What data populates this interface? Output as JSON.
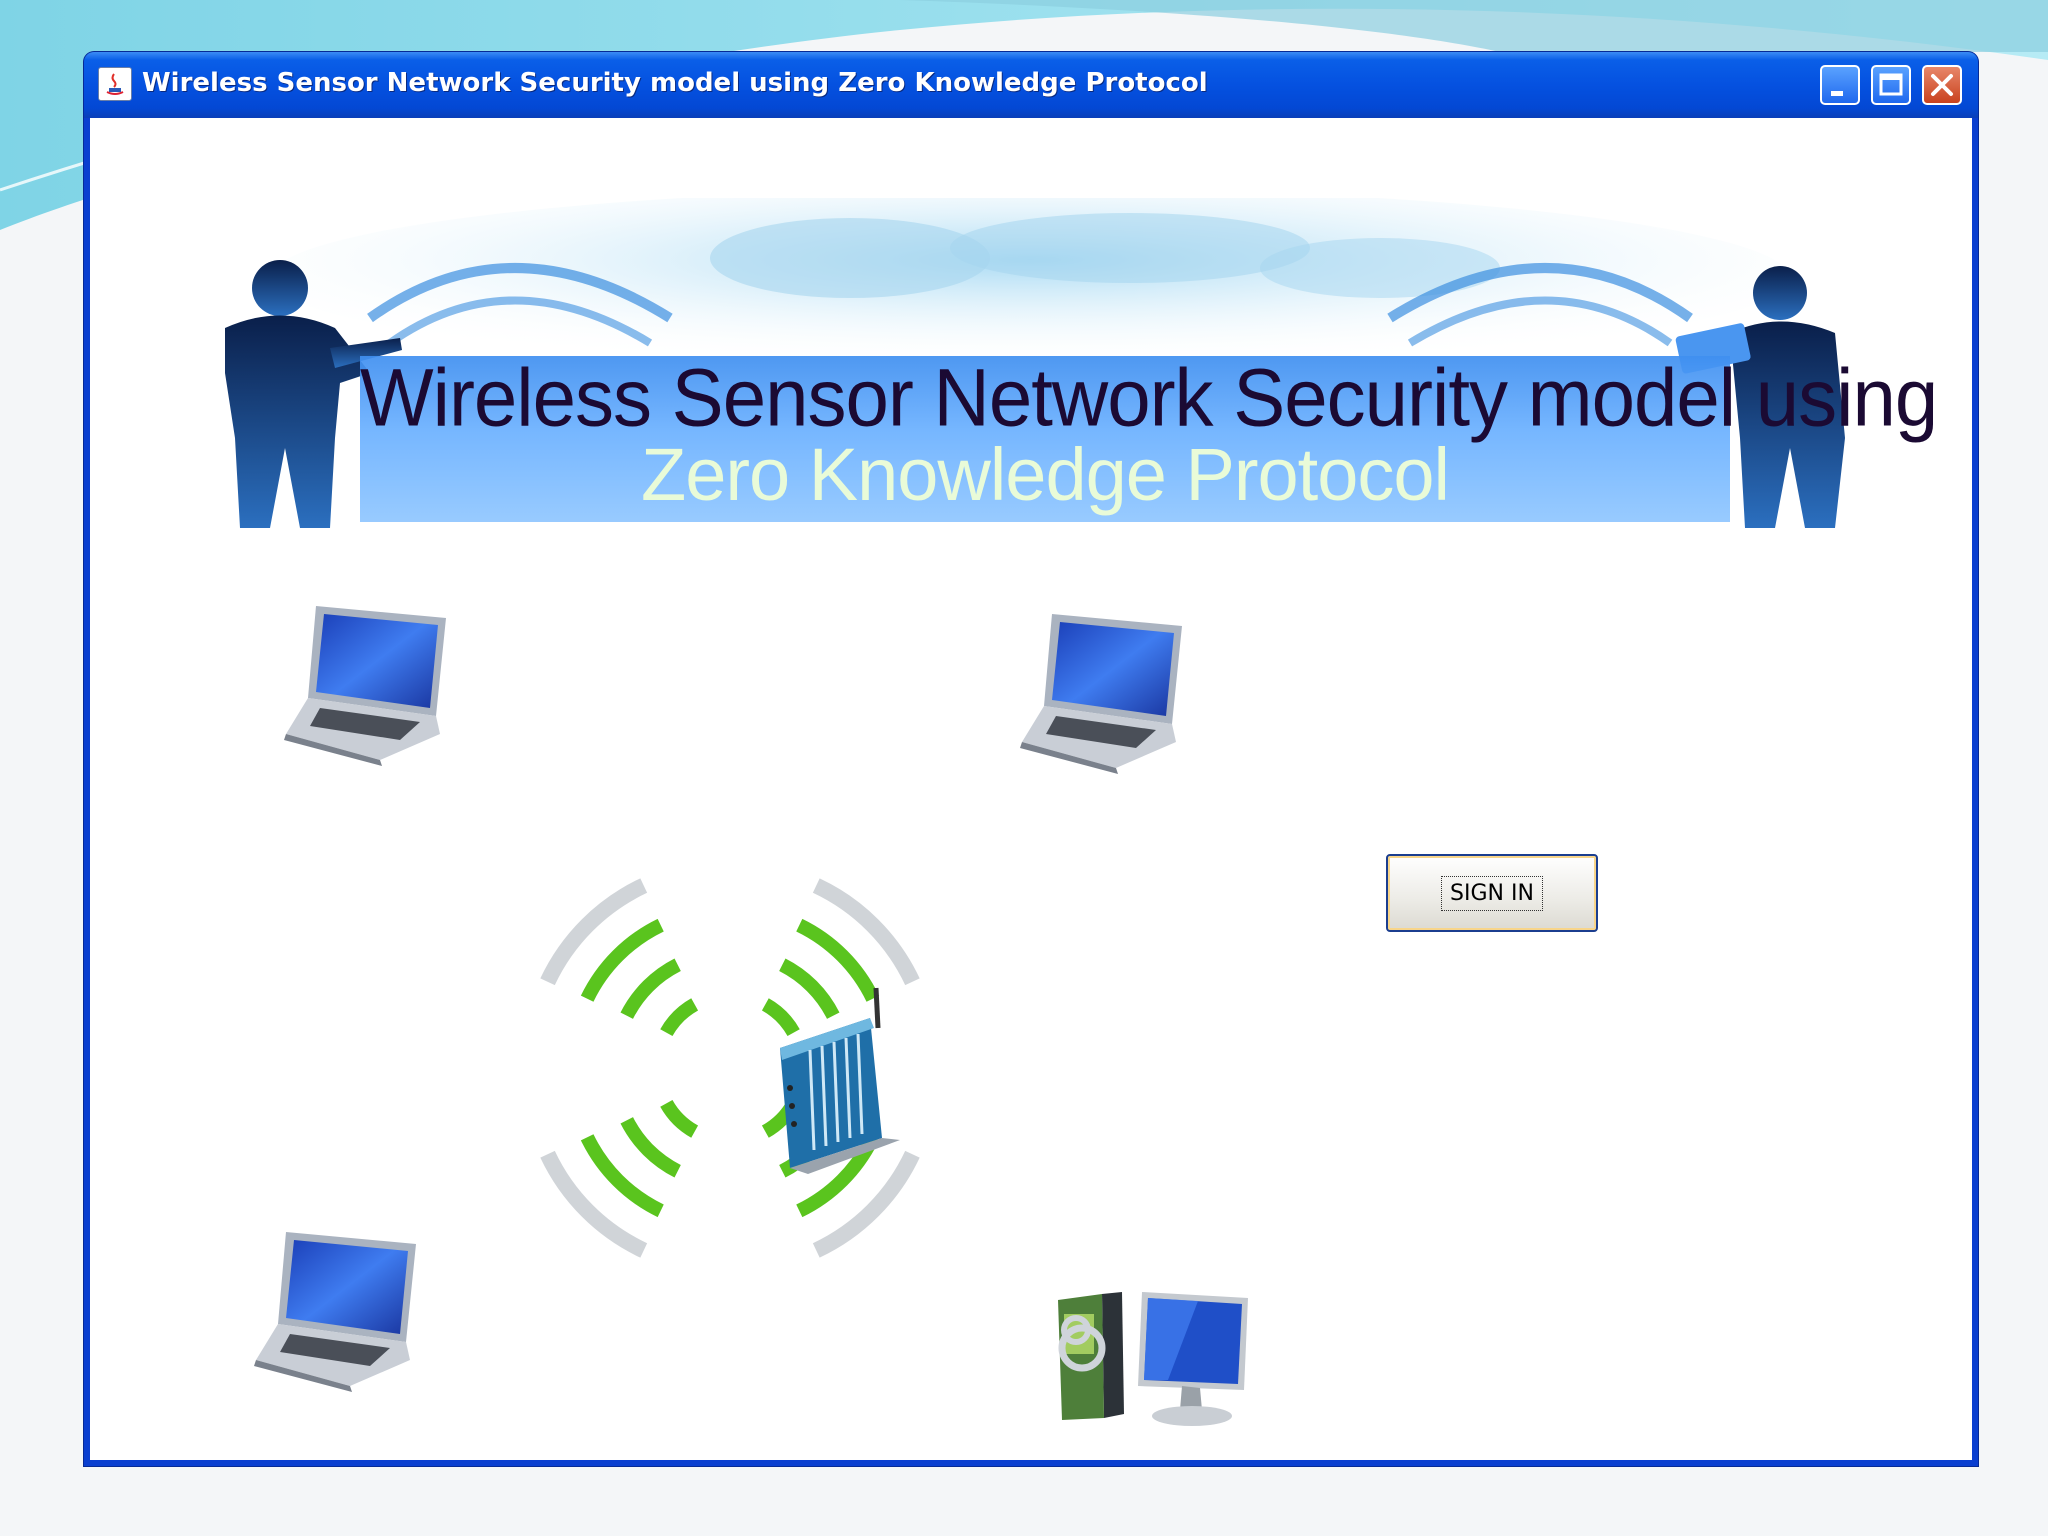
{
  "window": {
    "title": "Wireless Sensor Network Security model using Zero Knowledge Protocol",
    "controls": {
      "minimize": "minimize",
      "maximize": "maximize",
      "close": "close"
    }
  },
  "banner": {
    "line1": "Wireless Sensor Network Security model using",
    "line2": "Zero Knowledge Protocol"
  },
  "actions": {
    "sign_in_label": "SIGN IN"
  },
  "devices": [
    "laptop",
    "laptop",
    "laptop",
    "wireless-router",
    "desktop-computer"
  ],
  "colors": {
    "titlebar": "#0551e0",
    "signal_green": "#5ac41e",
    "banner_blue": "#4a96f0"
  }
}
